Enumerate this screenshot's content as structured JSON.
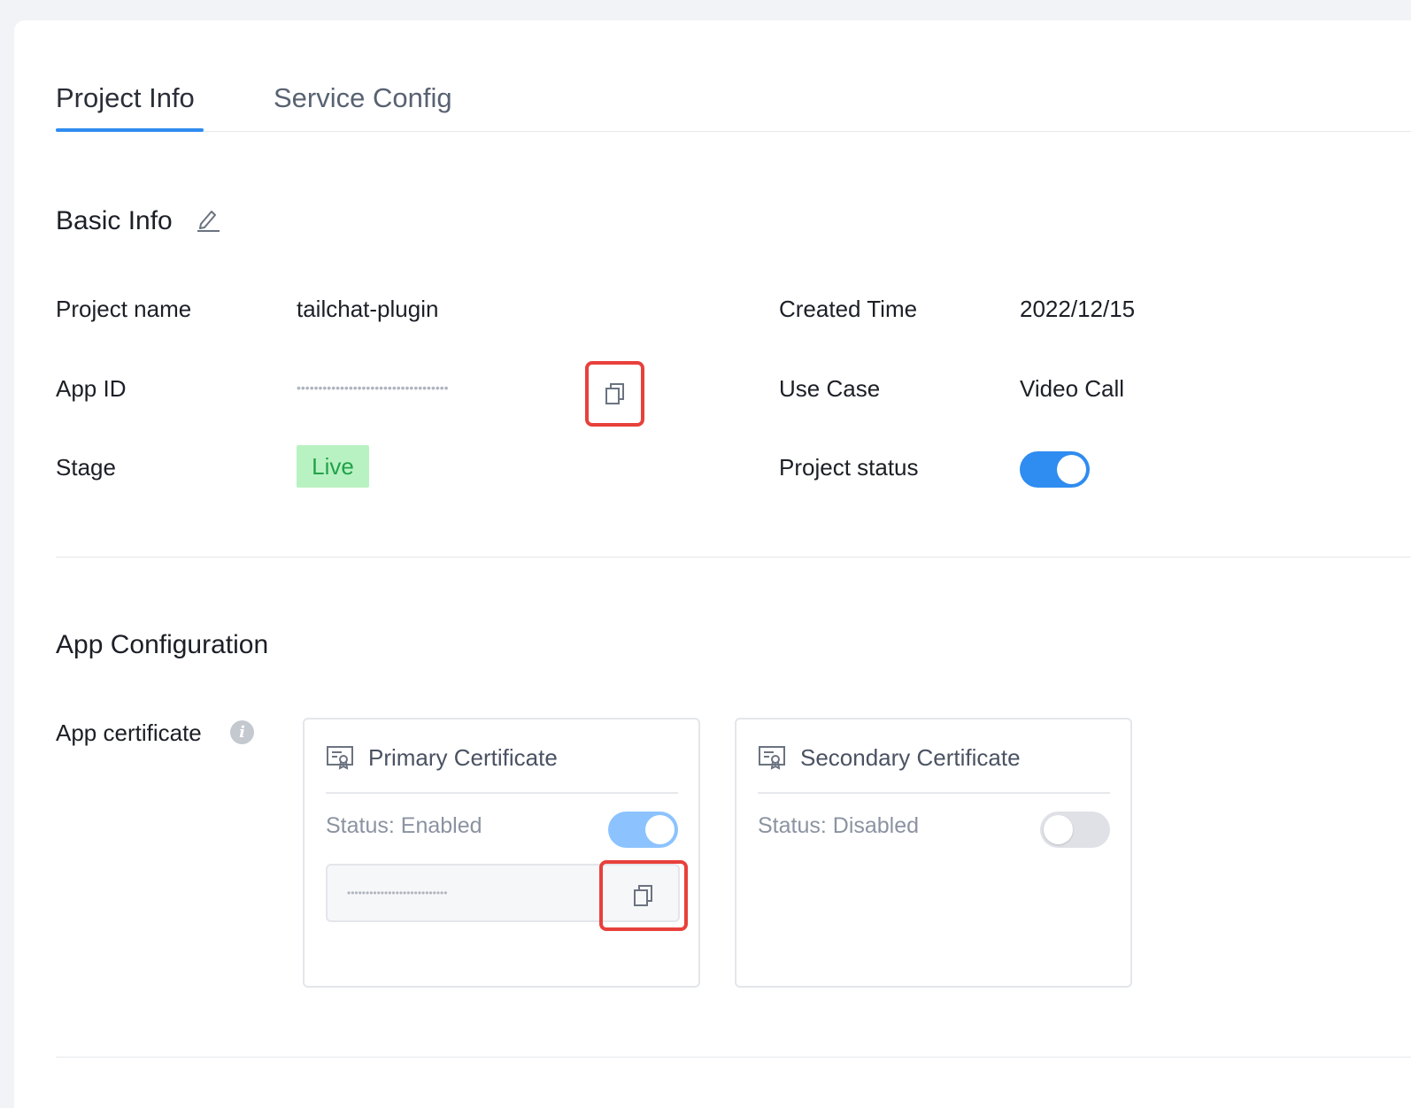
{
  "tabs": [
    {
      "label": "Project Info",
      "active": true
    },
    {
      "label": "Service Config",
      "active": false
    }
  ],
  "basic_info": {
    "title": "Basic Info",
    "fields": {
      "project_name": {
        "label": "Project name",
        "value": "tailchat-plugin"
      },
      "app_id": {
        "label": "App ID",
        "value": "•••••••••••••••••••••••••••••••••••"
      },
      "stage": {
        "label": "Stage",
        "value": "Live"
      },
      "created_time": {
        "label": "Created Time",
        "value": "2022/12/15"
      },
      "use_case": {
        "label": "Use Case",
        "value": "Video Call"
      },
      "project_status": {
        "label": "Project status",
        "enabled": true
      }
    }
  },
  "app_configuration": {
    "title": "App Configuration",
    "app_certificate_label": "App certificate",
    "info_glyph": "i",
    "primary": {
      "title": "Primary Certificate",
      "status": "Status: Enabled",
      "enabled": true,
      "masked_value": "•••••••••••••••••••••••••••"
    },
    "secondary": {
      "title": "Secondary Certificate",
      "status": "Status: Disabled",
      "enabled": false
    }
  },
  "colors": {
    "accent": "#2f8cf0",
    "toggle_on_light": "#8cc3ff",
    "toggle_off": "#dfe1e6",
    "live_bg": "#b9f2c2",
    "live_text": "#21a24a",
    "highlight": "#e8403b"
  },
  "icons": {
    "edit": "pencil-icon",
    "copy": "copy-icon",
    "info": "info-icon",
    "certificate": "certificate-icon"
  }
}
